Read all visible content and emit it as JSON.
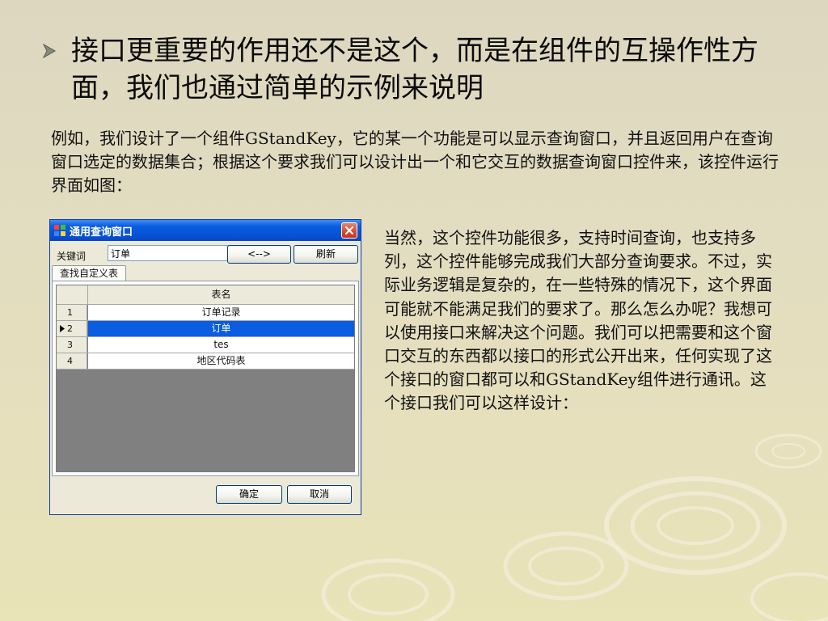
{
  "slide": {
    "title": "接口更重要的作用还不是这个，而是在组件的互操作性方面，我们也通过简单的示例来说明",
    "intro": "例如，我们设计了一个组件GStandKey，它的某一个功能是可以显示查询窗口，并且返回用户在查询窗口选定的数据集合；根据这个要求我们可以设计出一个和它交互的数据查询窗口控件来，该控件运行界面如图：",
    "side_text": "当然，这个控件功能很多，支持时间查询，也支持多列，这个控件能够完成我们大部分查询要求。不过，实际业务逻辑是复杂的，在一些特殊的情况下，这个界面可能就不能满足我们的要求了。那么怎么办呢？我想可以使用接口来解决这个问题。我们可以把需要和这个窗口交互的东西都以接口的形式公开出来，任何实现了这个接口的窗口都可以和GStandKey组件进行通讯。这个接口我们可以这样设计："
  },
  "dialog": {
    "title": "通用查询窗口",
    "keyword_label": "关键词",
    "keyword_value": "订单",
    "prev_button": "<-->",
    "refresh_button": "刷新",
    "tab_label": "查找自定义表",
    "column_header": "表名",
    "rows": [
      {
        "num": "1",
        "name": "订单记录",
        "selected": false
      },
      {
        "num": "2",
        "name": "订单",
        "selected": true
      },
      {
        "num": "3",
        "name": "tes",
        "selected": false
      },
      {
        "num": "4",
        "name": "地区代码表",
        "selected": false
      }
    ],
    "ok_button": "确定",
    "cancel_button": "取消"
  },
  "colors": {
    "titlebar": "#0a5ce0",
    "selection": "#0a5ce0",
    "close_button": "#d6472c"
  },
  "icons": [
    "bullet-arrow-icon",
    "app-window-icon",
    "close-icon",
    "row-pointer-icon"
  ]
}
